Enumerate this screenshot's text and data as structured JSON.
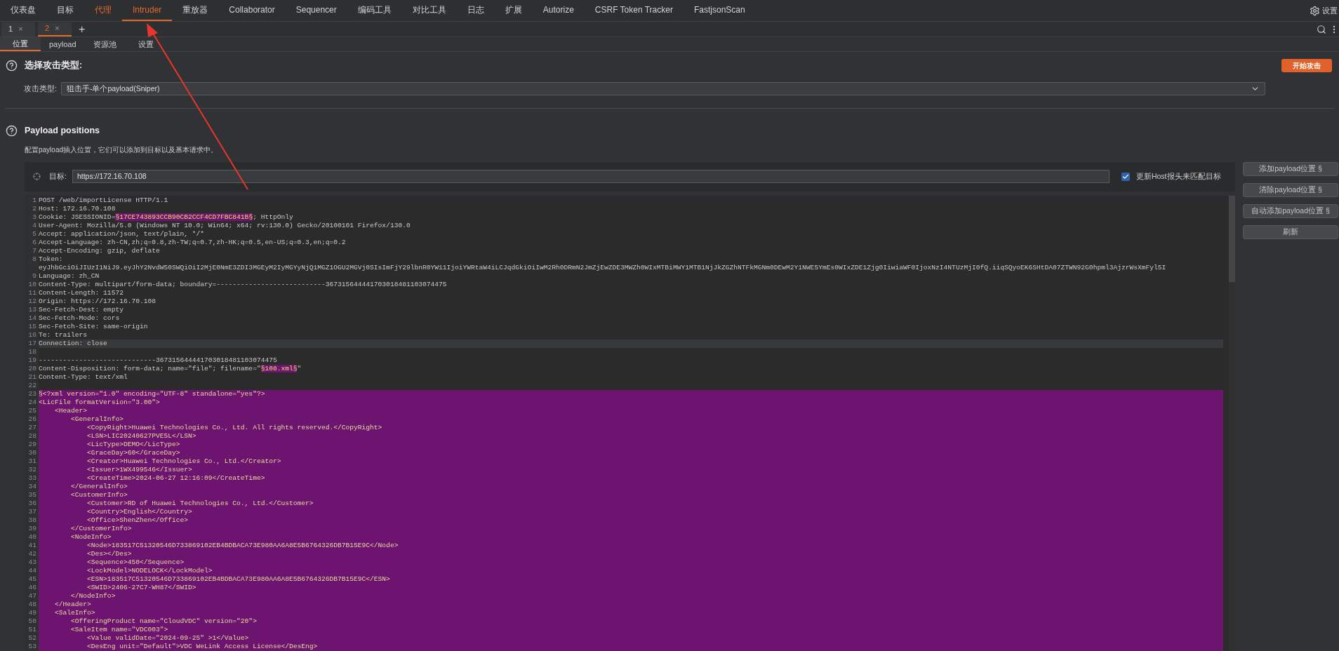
{
  "menu": {
    "items": [
      {
        "label": "仪表盘",
        "selected": false,
        "highlighted": false
      },
      {
        "label": "目标",
        "selected": false,
        "highlighted": false
      },
      {
        "label": "代理",
        "selected": false,
        "highlighted": true
      },
      {
        "label": "Intruder",
        "selected": true,
        "highlighted": false
      },
      {
        "label": "重放器",
        "selected": false,
        "highlighted": false
      },
      {
        "label": "Collaborator",
        "selected": false,
        "highlighted": false
      },
      {
        "label": "Sequencer",
        "selected": false,
        "highlighted": false
      },
      {
        "label": "编码工具",
        "selected": false,
        "highlighted": false
      },
      {
        "label": "对比工具",
        "selected": false,
        "highlighted": false
      },
      {
        "label": "日志",
        "selected": false,
        "highlighted": false
      },
      {
        "label": "扩展",
        "selected": false,
        "highlighted": false
      },
      {
        "label": "Autorize",
        "selected": false,
        "highlighted": false
      },
      {
        "label": "CSRF Token Tracker",
        "selected": false,
        "highlighted": false
      },
      {
        "label": "FastjsonScan",
        "selected": false,
        "highlighted": false
      }
    ],
    "settings": "设置"
  },
  "request_tabs": {
    "tabs": [
      {
        "label": "1",
        "close": "×",
        "selected": false
      },
      {
        "label": "2",
        "close": "×",
        "selected": true
      }
    ],
    "add": "+"
  },
  "sub_tabs": [
    {
      "label": "位置",
      "selected": true
    },
    {
      "label": "payload",
      "selected": false
    },
    {
      "label": "资源池",
      "selected": false
    },
    {
      "label": "设置",
      "selected": false
    }
  ],
  "attack_type": {
    "title": "选择攻击类型:",
    "start_button": "开始攻击",
    "label": "攻击类型:",
    "value": "狙击手-单个payload(Sniper)"
  },
  "payload_positions": {
    "title": "Payload positions",
    "description": "配置payload插入位置，它们可以添加到目标以及基本请求中。"
  },
  "target": {
    "label": "目标:",
    "value": "https://172.16.70.108",
    "update_host": {
      "label": "更新Host报头来匹配目标",
      "checked": true
    }
  },
  "side_buttons": [
    "添加payload位置 §",
    "清除payload位置 §",
    "自动添加payload位置 §",
    "刷新"
  ],
  "editor": {
    "lines": [
      {
        "number": "1",
        "text": "POST /web/importLicense HTTP/1.1",
        "current": false,
        "in_payload": false
      },
      {
        "number": "2",
        "text": "Host: 172.16.70.108",
        "current": false,
        "in_payload": false
      },
      {
        "number": "3",
        "segments": [
          {
            "text": "Cookie: JSESSIONID=",
            "marked": false
          },
          {
            "text": "§17CE743893CCB90CB2CCF4CD7FBC841B§",
            "marked": true
          },
          {
            "text": "; HttpOnly",
            "marked": false
          }
        ],
        "current": false,
        "in_payload": false
      },
      {
        "number": "4",
        "text": "User-Agent: Mozilla/5.0 (Windows NT 10.0; Win64; x64; rv:130.0) Gecko/20100101 Firefox/130.0",
        "current": false,
        "in_payload": false
      },
      {
        "number": "5",
        "text": "Accept: application/json, text/plain, */*",
        "current": false,
        "in_payload": false
      },
      {
        "number": "6",
        "text": "Accept-Language: zh-CN,zh;q=0.8,zh-TW;q=0.7,zh-HK;q=0.5,en-US;q=0.3,en;q=0.2",
        "current": false,
        "in_payload": false
      },
      {
        "number": "7",
        "text": "Accept-Encoding: gzip, deflate",
        "current": false,
        "in_payload": false
      },
      {
        "number": "8",
        "text": "Token:",
        "continuation": "eyJhbGciOiJIUzI1NiJ9.eyJhY2NvdW50SWQiOiI2MjE0NmE3ZDI3MGEyM2IyMGYyNjQ1MGZ1OGU2MGVj0SIsImFjY29lbnR0YW11IjoiYWRtaW4iLCJqdGkiOiIwM2Rh0DRmN2JmZjEwZDE3MWZh0WIxMTBiMWY1MTB1NjJkZGZhNTFkMGNm0DEwM2Y1NWE5YmEs0WIxZDE1Zjg0IiwiaWF0IjoxNzI4NTUzMjI0fQ.iiqSQyoEK6SHtDA07ZTWN92G0hpml3AjzrWsXmFyl5I",
        "current": false,
        "in_payload": false
      },
      {
        "number": "9",
        "text": "Language: zh_CN",
        "current": false,
        "in_payload": false
      },
      {
        "number": "10",
        "text": "Content-Type: multipart/form-data; boundary=---------------------------367315644441703018481103074475",
        "current": false,
        "in_payload": false
      },
      {
        "number": "11",
        "text": "Content-Length: 11572",
        "current": false,
        "in_payload": false
      },
      {
        "number": "12",
        "text": "Origin: https://172.16.70.108",
        "current": false,
        "in_payload": false
      },
      {
        "number": "13",
        "text": "Sec-Fetch-Dest: empty",
        "current": false,
        "in_payload": false
      },
      {
        "number": "14",
        "text": "Sec-Fetch-Mode: cors",
        "current": false,
        "in_payload": false
      },
      {
        "number": "15",
        "text": "Sec-Fetch-Site: same-origin",
        "current": false,
        "in_payload": false
      },
      {
        "number": "16",
        "text": "Te: trailers",
        "current": false,
        "in_payload": false
      },
      {
        "number": "17",
        "text": "Connection: close",
        "current": true,
        "in_payload": false
      },
      {
        "number": "18",
        "current": false,
        "in_payload": false
      },
      {
        "number": "19",
        "text": "-----------------------------367315644441703018481103074475",
        "current": false,
        "in_payload": false
      },
      {
        "number": "20",
        "segments": [
          {
            "text": "Content-Disposition: form-data; name=\"file\"; filename=\"",
            "marked": false
          },
          {
            "text": "§108.xml§",
            "marked": true
          },
          {
            "text": "\"",
            "marked": false
          }
        ],
        "current": false,
        "in_payload": false
      },
      {
        "number": "21",
        "text": "Content-Type: text/xml",
        "current": false,
        "in_payload": false
      },
      {
        "number": "22",
        "current": false,
        "in_payload": false
      },
      {
        "number": "23",
        "text": "§<?xml version=\"1.0\" encoding=\"UTF-8\" standalone=\"yes\"?>",
        "current": false,
        "in_payload": true
      },
      {
        "number": "24",
        "text": "<LicFile formatVersion=\"3.00\">",
        "current": false,
        "in_payload": true
      },
      {
        "number": "25",
        "text": "    <Header>",
        "current": false,
        "in_payload": true
      },
      {
        "number": "26",
        "text": "        <GeneralInfo>",
        "current": false,
        "in_payload": true
      },
      {
        "number": "27",
        "text": "            <CopyRight>Huawei Technologies Co., Ltd. All rights reserved.</CopyRight>",
        "current": false,
        "in_payload": true
      },
      {
        "number": "28",
        "text": "            <LSN>LIC20240627PVE5L</LSN>",
        "current": false,
        "in_payload": true
      },
      {
        "number": "29",
        "text": "            <LicType>DEMO</LicType>",
        "current": false,
        "in_payload": true
      },
      {
        "number": "30",
        "text": "            <GraceDay>60</GraceDay>",
        "current": false,
        "in_payload": true
      },
      {
        "number": "31",
        "text": "            <Creator>Huawei Technologies Co., Ltd.</Creator>",
        "current": false,
        "in_payload": true
      },
      {
        "number": "32",
        "text": "            <Issuer>1WX499546</Issuer>",
        "current": false,
        "in_payload": true
      },
      {
        "number": "33",
        "text": "            <CreateTime>2024-06-27 12:16:09</CreateTime>",
        "current": false,
        "in_payload": true
      },
      {
        "number": "34",
        "text": "        </GeneralInfo>",
        "current": false,
        "in_payload": true
      },
      {
        "number": "35",
        "text": "        <CustomerInfo>",
        "current": false,
        "in_payload": true
      },
      {
        "number": "36",
        "text": "            <Customer>RD of Huawei Technologies Co., Ltd.</Customer>",
        "current": false,
        "in_payload": true
      },
      {
        "number": "37",
        "text": "            <Country>English</Country>",
        "current": false,
        "in_payload": true
      },
      {
        "number": "38",
        "text": "            <Office>ShenZhen</Office>",
        "current": false,
        "in_payload": true
      },
      {
        "number": "39",
        "text": "        </CustomerInfo>",
        "current": false,
        "in_payload": true
      },
      {
        "number": "40",
        "text": "        <NodeInfo>",
        "current": false,
        "in_payload": true
      },
      {
        "number": "41",
        "text": "            <Node>183517C51320546D733869102EB4BDBACA73E980AA6A8E5B6764326DB7B15E9C</Node>",
        "current": false,
        "in_payload": true
      },
      {
        "number": "42",
        "text": "            <Des></Des>",
        "current": false,
        "in_payload": true
      },
      {
        "number": "43",
        "text": "            <Sequence>450</Sequence>",
        "current": false,
        "in_payload": true
      },
      {
        "number": "44",
        "text": "            <LockModel>NODELOCK</LockModel>",
        "current": false,
        "in_payload": true
      },
      {
        "number": "45",
        "text": "            <ESN>183517C51320546D733869102EB4BDBACA73E980AA6A8E5B6764326DB7B15E9C</ESN>",
        "current": false,
        "in_payload": true
      },
      {
        "number": "46",
        "text": "            <SWID>2406-27C7-WH87</SWID>",
        "current": false,
        "in_payload": true
      },
      {
        "number": "47",
        "text": "        </NodeInfo>",
        "current": false,
        "in_payload": true
      },
      {
        "number": "48",
        "text": "    </Header>",
        "current": false,
        "in_payload": true
      },
      {
        "number": "49",
        "text": "    <SaleInfo>",
        "current": false,
        "in_payload": true
      },
      {
        "number": "50",
        "text": "        <OfferingProduct name=\"CloudVDC\" version=\"20\">",
        "current": false,
        "in_payload": true
      },
      {
        "number": "51",
        "text": "        <SaleItem name=\"VDC003\">",
        "current": false,
        "in_payload": true
      },
      {
        "number": "52",
        "text": "            <Value validDate=\"2024-09-25\" >1</Value>",
        "current": false,
        "in_payload": true
      },
      {
        "number": "53",
        "text": "            <DesEng unit=\"Default\">VDC WeLink Access License</DesEng>",
        "current": false,
        "in_payload": true
      }
    ]
  }
}
